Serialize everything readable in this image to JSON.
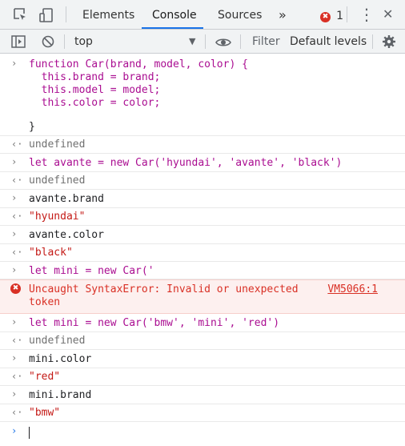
{
  "tabs": {
    "elements": "Elements",
    "console": "Console",
    "sources": "Sources",
    "more": "»",
    "error_count": "1"
  },
  "toolbar": {
    "context": "top",
    "filter_placeholder": "Filter",
    "levels": "Default levels"
  },
  "console": {
    "fn_lines": [
      "function Car(brand, model, color) {",
      "  this.brand = brand;",
      "  this.model = model;",
      "  this.color = color;",
      "",
      "}"
    ],
    "undefined_text": "undefined",
    "line_avante": "let avante = new Car('hyundai', 'avante', 'black')",
    "avante_brand": "avante.brand",
    "result_hyundai": "\"hyundai\"",
    "avante_color": "avante.color",
    "result_black": "\"black\"",
    "line_mini_incomplete": "let mini = new Car('",
    "error_message_line1": "Uncaught SyntaxError: Invalid or unexpected",
    "error_message_line2": "token",
    "error_source": "VM5066:1",
    "line_mini": "let mini = new Car('bmw', 'mini', 'red')",
    "mini_color": "mini.color",
    "result_red": "\"red\"",
    "mini_brand": "mini.brand",
    "result_bmw": "\"bmw\""
  },
  "icons": {
    "input_prompt": "›",
    "output_arrow": "‹·",
    "error_badge": "✖",
    "kebab": "⋮",
    "close": "✕",
    "dropdown": "▼"
  },
  "colors": {
    "accent": "#1a73e8",
    "error": "#d93025",
    "keyword": "#aa0d91",
    "string": "#c41a16"
  }
}
